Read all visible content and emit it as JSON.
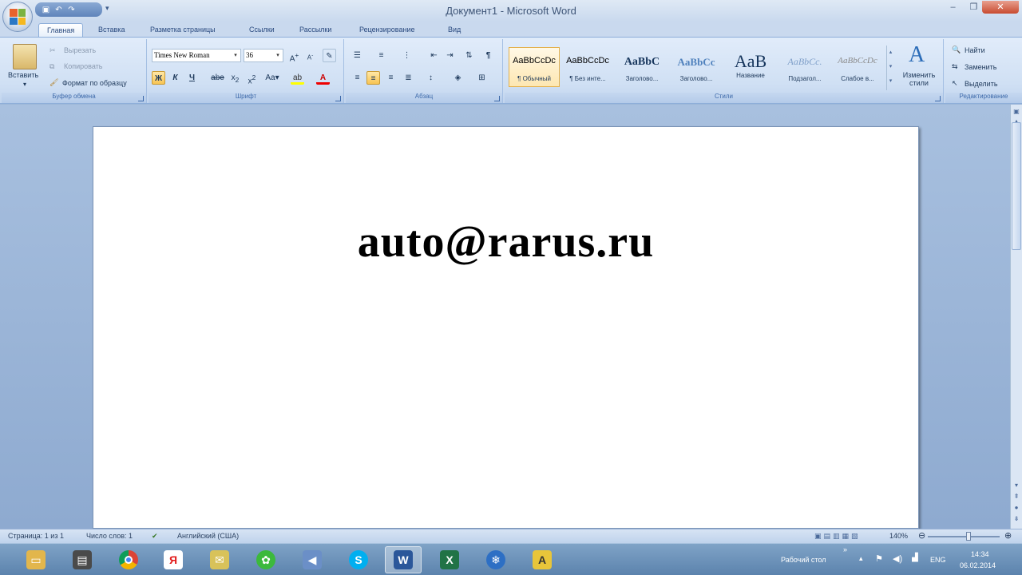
{
  "window": {
    "title": "Документ1 - Microsoft Word"
  },
  "qat": {
    "more": "▾"
  },
  "tabs": [
    "Главная",
    "Вставка",
    "Разметка страницы",
    "Ссылки",
    "Рассылки",
    "Рецензирование",
    "Вид"
  ],
  "ribbon": {
    "clipboard": {
      "paste": "Вставить",
      "cut": "Вырезать",
      "copy": "Копировать",
      "format_painter": "Формат по образцу",
      "label": "Буфер обмена"
    },
    "font": {
      "family": "Times New Roman",
      "size": "36",
      "label": "Шрифт"
    },
    "paragraph": {
      "label": "Абзац"
    },
    "styles": {
      "items": [
        {
          "preview": "AaBbCcDc",
          "name": "¶ Обычный"
        },
        {
          "preview": "AaBbCcDc",
          "name": "¶ Без инте..."
        },
        {
          "preview": "AaBbC",
          "name": "Заголово..."
        },
        {
          "preview": "AaBbCc",
          "name": "Заголово..."
        },
        {
          "preview": "AaB",
          "name": "Название"
        },
        {
          "preview": "AaBbCc.",
          "name": "Подзагол..."
        },
        {
          "preview": "AaBbCcDc",
          "name": "Слабое в..."
        }
      ],
      "change": "Изменить стили",
      "label": "Стили"
    },
    "editing": {
      "find": "Найти",
      "replace": "Заменить",
      "select": "Выделить",
      "label": "Редактирование"
    }
  },
  "document": {
    "text": "auto@rarus.ru"
  },
  "status": {
    "page": "Страница: 1 из 1",
    "words": "Число слов: 1",
    "language": "Английский (США)",
    "zoom": "140%"
  },
  "taskbar": {
    "desktop": "Рабочий стол",
    "lang": "ENG",
    "time": "14:34",
    "date": "06.02.2014"
  }
}
